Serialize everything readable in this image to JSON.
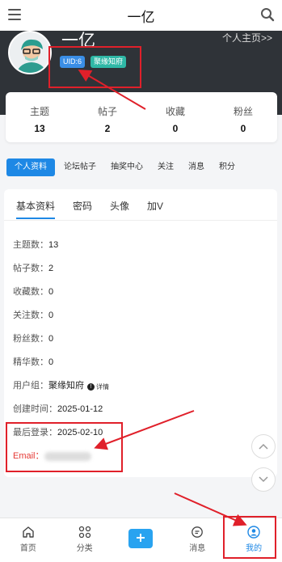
{
  "header": {
    "title": "一亿"
  },
  "profile": {
    "name": "一亿",
    "home_link": "个人主页>>",
    "uid": "UID:6",
    "group_badge": "聚缘知府"
  },
  "stats": [
    {
      "label": "主题",
      "value": "13"
    },
    {
      "label": "帖子",
      "value": "2"
    },
    {
      "label": "收藏",
      "value": "0"
    },
    {
      "label": "粉丝",
      "value": "0"
    }
  ],
  "section_tabs": [
    "个人资料",
    "论坛帖子",
    "抽奖中心",
    "关注",
    "消息",
    "积分"
  ],
  "sub_tabs": [
    "基本资料",
    "密码",
    "头像",
    "加V"
  ],
  "info": {
    "topics": {
      "label": "主题数：",
      "value": "13"
    },
    "posts": {
      "label": "帖子数：",
      "value": "2"
    },
    "favorites": {
      "label": "收藏数：",
      "value": "0"
    },
    "following": {
      "label": "关注数：",
      "value": "0"
    },
    "fans": {
      "label": "粉丝数：",
      "value": "0"
    },
    "essence": {
      "label": "精华数：",
      "value": "0"
    },
    "group": {
      "label": "用户组：",
      "value": "聚缘知府",
      "detail": "详情"
    },
    "created": {
      "label": "创建时间：",
      "value": "2025-01-12"
    },
    "last_login": {
      "label": "最后登录：",
      "value": "2025-02-10"
    },
    "email": {
      "label": "Email："
    }
  },
  "bottom_nav": {
    "home": "首页",
    "category": "分类",
    "messages": "消息",
    "mine": "我的"
  },
  "colors": {
    "accent": "#1e88e5",
    "annotation": "#e0202a",
    "banner": "#2f3338"
  }
}
